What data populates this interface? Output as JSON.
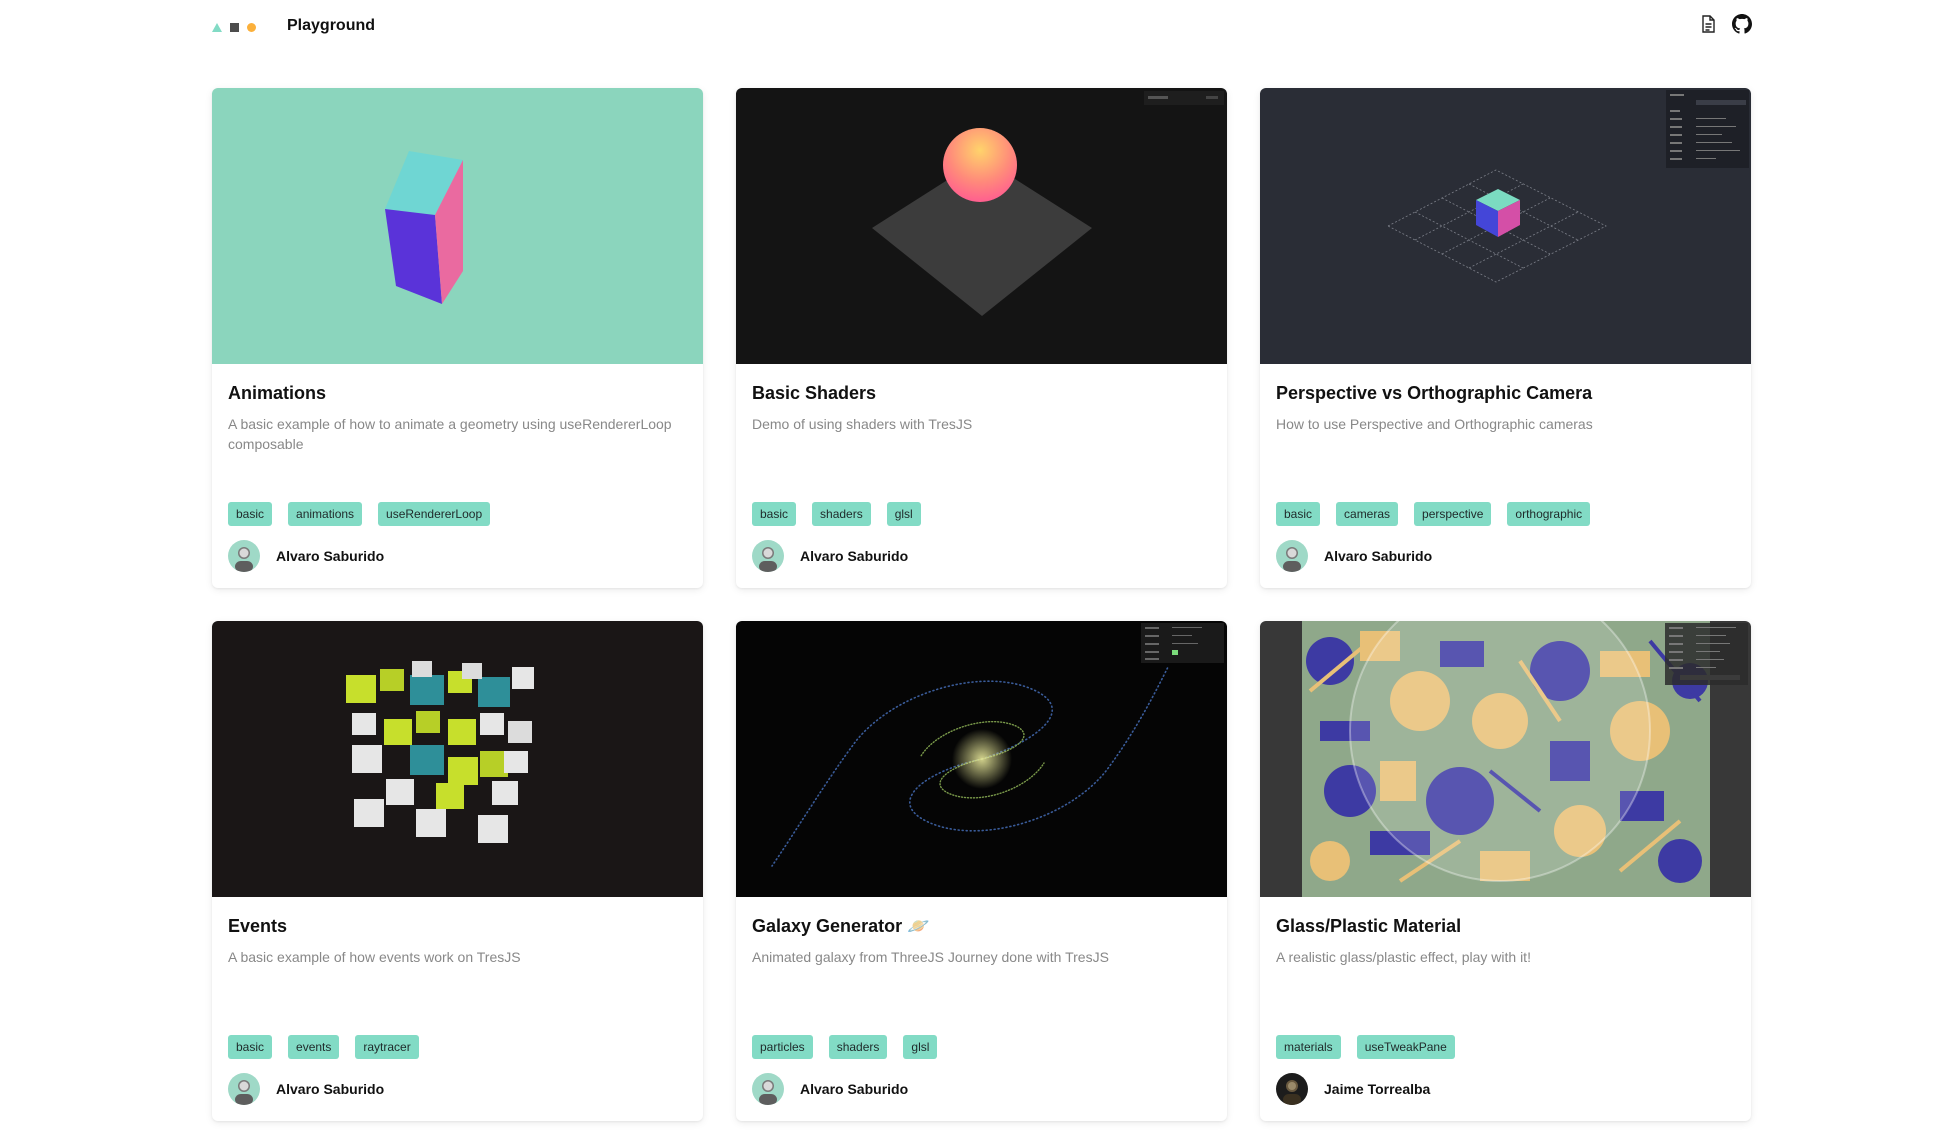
{
  "app": {
    "brand": "Playground"
  },
  "header": {
    "icons": [
      "document-icon",
      "github-icon"
    ]
  },
  "colors": {
    "accent": "#82dbc5",
    "tag_text": "#1f2a2a",
    "muted_text": "#888888"
  },
  "cards": [
    {
      "title": "Animations",
      "description": "A basic example of how to animate a geometry using useRendererLoop composable",
      "tags": [
        "basic",
        "animations",
        "useRendererLoop"
      ],
      "author": "Alvaro Saburido"
    },
    {
      "title": "Basic Shaders",
      "description": "Demo of using shaders with TresJS",
      "tags": [
        "basic",
        "shaders",
        "glsl"
      ],
      "author": "Alvaro Saburido"
    },
    {
      "title": "Perspective vs Orthographic Camera",
      "description": "How to use Perspective and Orthographic cameras",
      "tags": [
        "basic",
        "cameras",
        "perspective",
        "orthographic"
      ],
      "author": "Alvaro Saburido"
    },
    {
      "title": "Events",
      "description": "A basic example of how events work on TresJS",
      "tags": [
        "basic",
        "events",
        "raytracer"
      ],
      "author": "Alvaro Saburido"
    },
    {
      "title": "Galaxy Generator 🪐",
      "description": "Animated galaxy from ThreeJS Journey done with TresJS",
      "tags": [
        "particles",
        "shaders",
        "glsl"
      ],
      "author": "Alvaro Saburido"
    },
    {
      "title": "Glass/Plastic Material",
      "description": "A realistic glass/plastic effect, play with it!",
      "tags": [
        "materials",
        "useTweakPane"
      ],
      "author": "Jaime Torrealba"
    }
  ]
}
